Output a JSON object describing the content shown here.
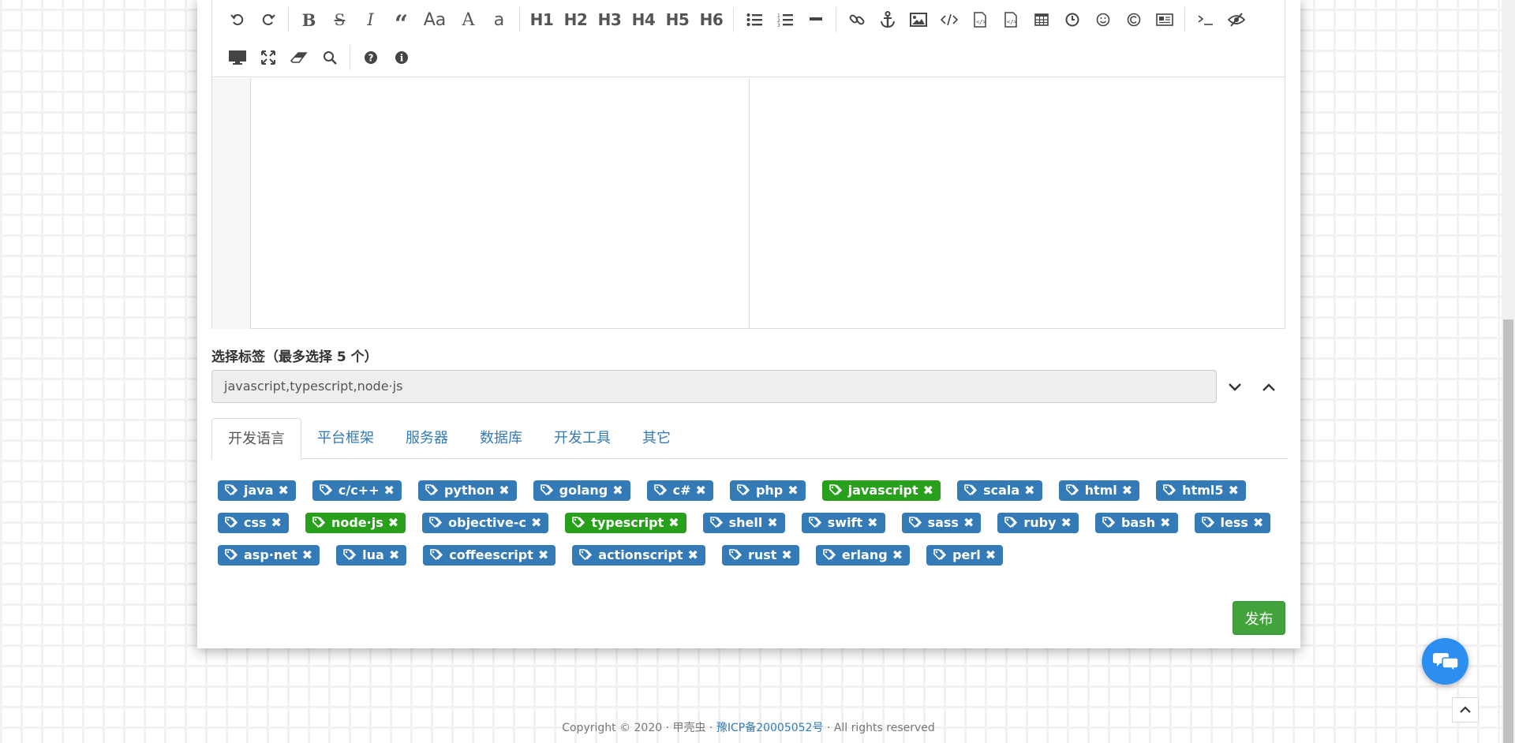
{
  "editor": {
    "toolbar": [
      {
        "name": "undo-icon"
      },
      {
        "name": "redo-icon"
      },
      {
        "name": "bold-icon"
      },
      {
        "name": "strikethrough-icon"
      },
      {
        "name": "italic-icon"
      },
      {
        "name": "quote-icon"
      },
      {
        "name": "uppercase-icon"
      },
      {
        "name": "font-size-up-icon"
      },
      {
        "name": "lowercase-icon"
      },
      {
        "name": "heading-1",
        "label": "H1"
      },
      {
        "name": "heading-2",
        "label": "H2"
      },
      {
        "name": "heading-3",
        "label": "H3"
      },
      {
        "name": "heading-4",
        "label": "H4"
      },
      {
        "name": "heading-5",
        "label": "H5"
      },
      {
        "name": "heading-6",
        "label": "H6"
      }
    ]
  },
  "tags": {
    "label": "选择标签（最多选择 5 个）",
    "input_value": "javascript,typescript,node·js"
  },
  "tabs": [
    {
      "label": "开发语言",
      "active": true
    },
    {
      "label": "平台框架",
      "active": false
    },
    {
      "label": "服务器",
      "active": false
    },
    {
      "label": "数据库",
      "active": false
    },
    {
      "label": "开发工具",
      "active": false
    },
    {
      "label": "其它",
      "active": false
    }
  ],
  "tag_rows": [
    [
      {
        "label": "java",
        "selected": false
      },
      {
        "label": "c/c++",
        "selected": false
      },
      {
        "label": "python",
        "selected": false
      },
      {
        "label": "golang",
        "selected": false
      },
      {
        "label": "c#",
        "selected": false
      },
      {
        "label": "php",
        "selected": false
      },
      {
        "label": "javascript",
        "selected": true
      },
      {
        "label": "scala",
        "selected": false
      },
      {
        "label": "html",
        "selected": false
      },
      {
        "label": "html5",
        "selected": false
      }
    ],
    [
      {
        "label": "css",
        "selected": false
      },
      {
        "label": "node·js",
        "selected": true
      },
      {
        "label": "objective-c",
        "selected": false
      },
      {
        "label": "typescript",
        "selected": true
      },
      {
        "label": "shell",
        "selected": false
      },
      {
        "label": "swift",
        "selected": false
      },
      {
        "label": "sass",
        "selected": false
      },
      {
        "label": "ruby",
        "selected": false
      },
      {
        "label": "bash",
        "selected": false
      },
      {
        "label": "less",
        "selected": false
      }
    ],
    [
      {
        "label": "asp·net",
        "selected": false
      },
      {
        "label": "lua",
        "selected": false
      },
      {
        "label": "coffeescript",
        "selected": false
      },
      {
        "label": "actionscript",
        "selected": false
      },
      {
        "label": "rust",
        "selected": false
      },
      {
        "label": "erlang",
        "selected": false
      },
      {
        "label": "perl",
        "selected": false
      }
    ]
  ],
  "publish_label": "发布",
  "footer": {
    "copyright": "Copyright © 2020 · 甲壳虫 · ",
    "icp": "豫ICP备20005052号",
    "rights": " · All rights reserved"
  },
  "colors": {
    "tag_default": "#337ab7",
    "tag_selected": "#28a01c",
    "publish": "#42a23c",
    "link": "#337ab7"
  }
}
